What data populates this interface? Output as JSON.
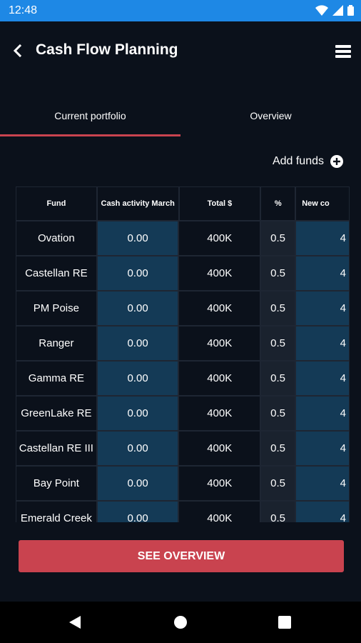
{
  "status": {
    "time": "12:48"
  },
  "header": {
    "title": "Cash Flow Planning"
  },
  "tabs": [
    {
      "label": "Current portfolio",
      "active": true
    },
    {
      "label": "Overview",
      "active": false
    }
  ],
  "add_funds": {
    "label": "Add funds"
  },
  "table": {
    "columns": [
      "Fund",
      "Cash activity March",
      "Total $",
      "%",
      "New co"
    ],
    "rows": [
      {
        "fund": "Ovation",
        "cash": "0.00",
        "total": "400K",
        "pct": "0.5",
        "new": "4"
      },
      {
        "fund": "Castellan RE",
        "cash": "0.00",
        "total": "400K",
        "pct": "0.5",
        "new": "4"
      },
      {
        "fund": "PM Poise",
        "cash": "0.00",
        "total": "400K",
        "pct": "0.5",
        "new": "4"
      },
      {
        "fund": "Ranger",
        "cash": "0.00",
        "total": "400K",
        "pct": "0.5",
        "new": "4"
      },
      {
        "fund": "Gamma RE",
        "cash": "0.00",
        "total": "400K",
        "pct": "0.5",
        "new": "4"
      },
      {
        "fund": "GreenLake RE",
        "cash": "0.00",
        "total": "400K",
        "pct": "0.5",
        "new": "4"
      },
      {
        "fund": "Castellan RE III",
        "cash": "0.00",
        "total": "400K",
        "pct": "0.5",
        "new": "4"
      },
      {
        "fund": "Bay Point",
        "cash": "0.00",
        "total": "400K",
        "pct": "0.5",
        "new": "4"
      },
      {
        "fund": "Emerald Creek",
        "cash": "0.00",
        "total": "400K",
        "pct": "0.5",
        "new": "4"
      }
    ]
  },
  "footer": {
    "button_label": "SEE OVERVIEW"
  },
  "colors": {
    "status_bar": "#1e88e5",
    "background": "#0b111b",
    "accent": "#c9434f",
    "input_cell": "#143a56"
  },
  "icons": [
    "wifi-icon",
    "signal-icon",
    "battery-icon",
    "back-arrow-icon",
    "menu-icon",
    "add-circle-icon",
    "nav-back-icon",
    "nav-home-icon",
    "nav-recents-icon"
  ]
}
